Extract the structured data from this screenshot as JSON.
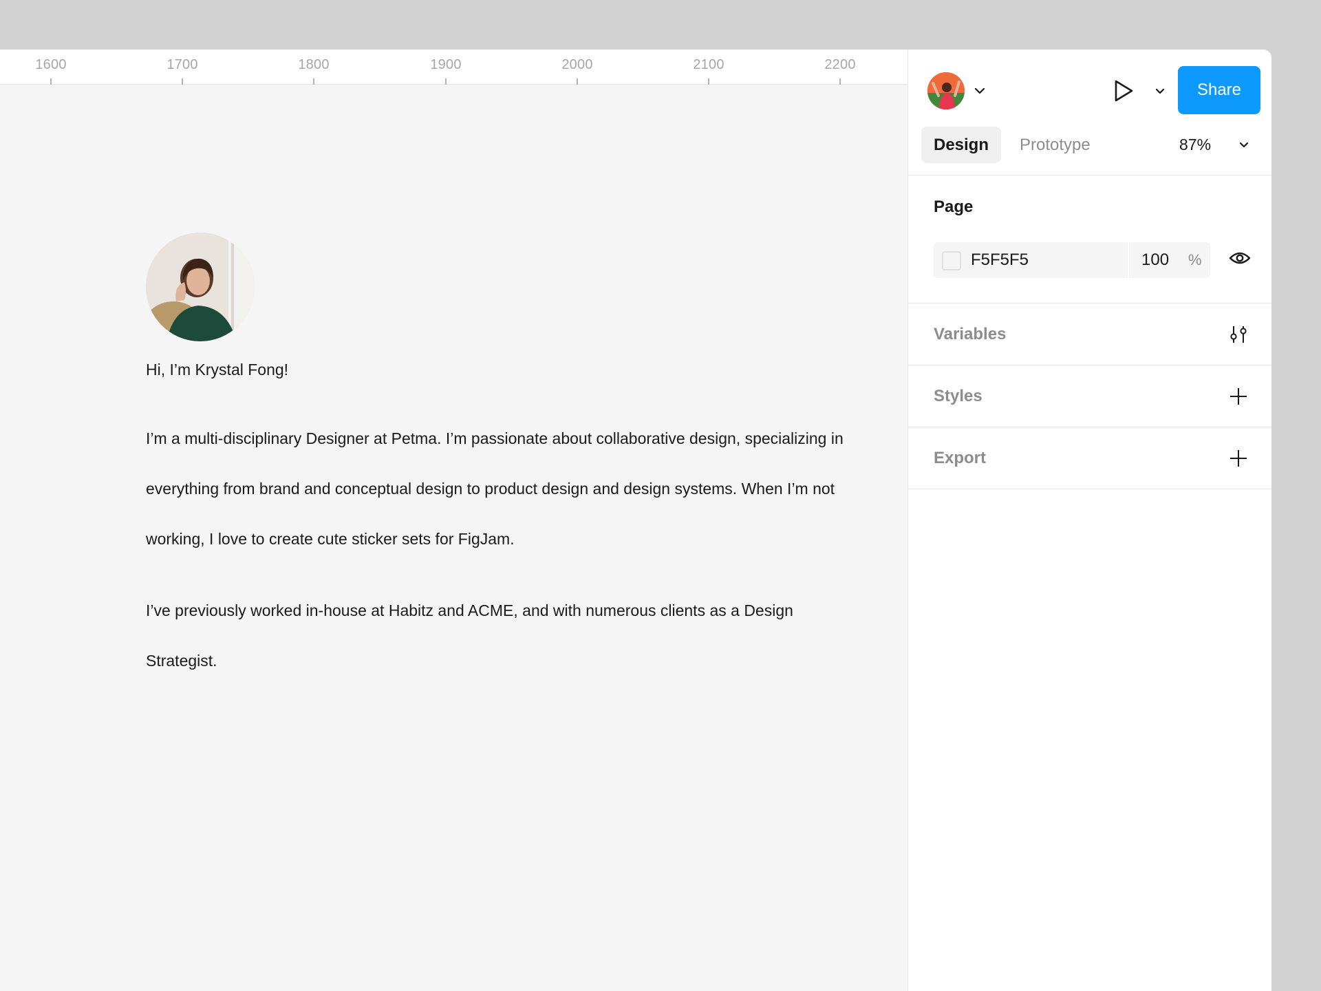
{
  "ruler": {
    "ticks": [
      "1600",
      "1700",
      "1800",
      "1900",
      "2000",
      "2100",
      "2200"
    ]
  },
  "canvas": {
    "greeting": "Hi, I’m Krystal Fong!",
    "bio_paragraph_1": "I’m a multi-disciplinary Designer at Petma. I’m passionate about collaborative design, specializing in everything from brand and conceptual design to product design and design systems. When I’m not working, I love to create cute sticker sets for FigJam.",
    "bio_paragraph_2": "I’ve previously worked in-house at Habitz and ACME, and with numerous clients as a Design Strategist."
  },
  "toolbar": {
    "share_label": "Share"
  },
  "tabs": {
    "design": "Design",
    "prototype": "Prototype"
  },
  "zoom": {
    "value": "87%"
  },
  "page_section": {
    "title": "Page",
    "color_hex": "F5F5F5",
    "opacity": "100",
    "opacity_unit": "%"
  },
  "sections": {
    "variables": "Variables",
    "styles": "Styles",
    "export": "Export"
  },
  "colors": {
    "accent": "#0d99ff",
    "canvas": "#f5f5f5",
    "panel": "#ffffff"
  },
  "icons": [
    "chevron-down-icon",
    "play-icon",
    "eye-icon",
    "sliders-icon",
    "plus-icon"
  ]
}
